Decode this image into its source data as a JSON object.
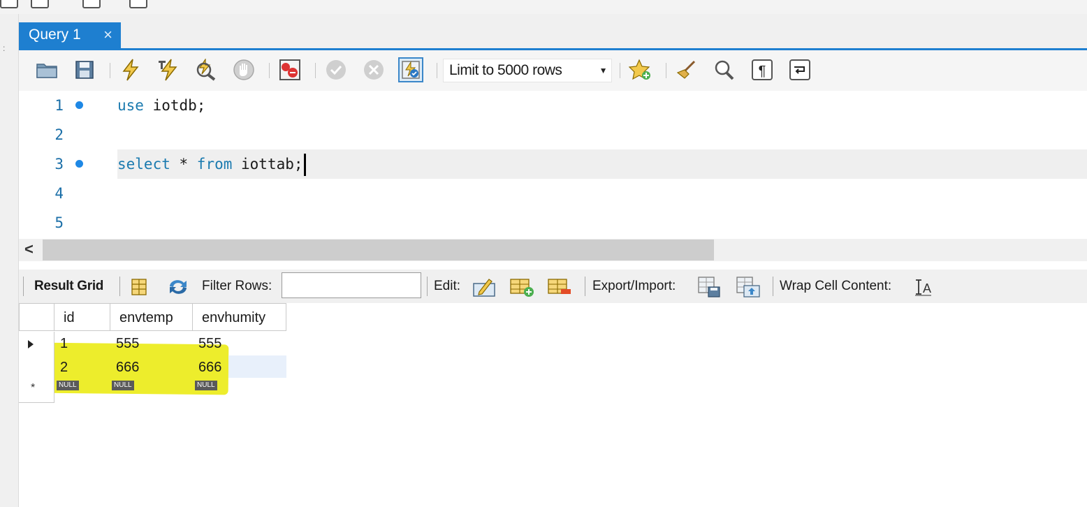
{
  "tab": {
    "label": "Query 1",
    "close_glyph": "×"
  },
  "toolbar": {
    "icons": [
      "open-folder-icon",
      "save-icon",
      "execute-icon",
      "execute-current-icon",
      "explain-icon",
      "stop-icon",
      "toggle-error-icon",
      "commit-icon",
      "rollback-icon",
      "autocommit-icon"
    ],
    "limit_label": "Limit to 5000 rows",
    "right_icons": [
      "add-snippet-icon",
      "beautify-icon",
      "find-icon",
      "invisible-chars-icon",
      "wrap-lines-icon"
    ]
  },
  "editor": {
    "lines": [
      {
        "number": "1",
        "breakpoint": true,
        "kw1": "use",
        "rest1": " iotdb;",
        "kw2": "",
        "rest2": "",
        "kw3": "",
        "rest3": ""
      },
      {
        "number": "2",
        "breakpoint": false,
        "kw1": "",
        "rest1": "",
        "kw2": "",
        "rest2": "",
        "kw3": "",
        "rest3": ""
      },
      {
        "number": "3",
        "breakpoint": true,
        "kw1": "select",
        "rest1": " * ",
        "kw2": "from",
        "rest2": " iottab;",
        "kw3": "",
        "rest3": ""
      },
      {
        "number": "4",
        "breakpoint": false,
        "kw1": "",
        "rest1": "",
        "kw2": "",
        "rest2": "",
        "kw3": "",
        "rest3": ""
      },
      {
        "number": "5",
        "breakpoint": false,
        "kw1": "",
        "rest1": "",
        "kw2": "",
        "rest2": "",
        "kw3": "",
        "rest3": ""
      }
    ]
  },
  "scrollbar": {
    "left_arrow": "<"
  },
  "result_toolbar": {
    "result_grid_label": "Result Grid",
    "filter_label": "Filter Rows:",
    "filter_value": "",
    "edit_label": "Edit:",
    "export_label": "Export/Import:",
    "wrap_label": "Wrap Cell Content:"
  },
  "grid": {
    "columns": [
      "id",
      "envtemp",
      "envhumity"
    ],
    "rows": [
      [
        "1",
        "555",
        "555"
      ],
      [
        "2",
        "666",
        "666"
      ]
    ],
    "null_label": "NULL",
    "new_row_marker": "*"
  },
  "colors": {
    "accent": "#1e7fd0",
    "highlight": "#ecec1a",
    "keyword": "#1a7aaf",
    "line_number": "#1b6fa8"
  }
}
